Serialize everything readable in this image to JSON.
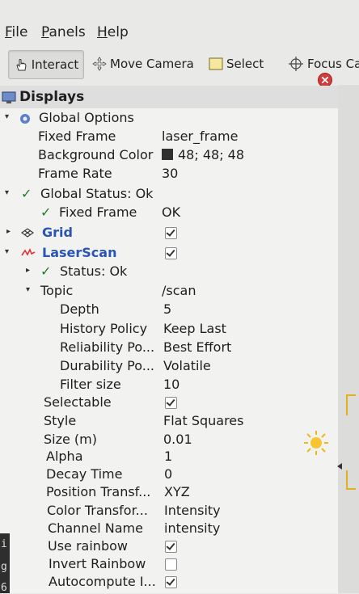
{
  "menubar": {
    "file": {
      "u": "F",
      "rest": "ile"
    },
    "panels": {
      "u": "P",
      "rest": "anels"
    },
    "help": {
      "u": "H",
      "rest": "elp"
    }
  },
  "toolbar": {
    "interact": "Interact",
    "move_camera": "Move Camera",
    "select": "Select",
    "focus_camera": "Focus Ca"
  },
  "displays": {
    "title": "Displays",
    "rows": [
      {
        "label": "Global Options",
        "value": ""
      },
      {
        "label": "Fixed Frame",
        "value": "laser_frame"
      },
      {
        "label": "Background Color",
        "value": "48; 48; 48"
      },
      {
        "label": "Frame Rate",
        "value": "30"
      },
      {
        "label": "Global Status: Ok",
        "value": ""
      },
      {
        "label": "Fixed Frame",
        "value": "OK"
      },
      {
        "label": "Grid",
        "value": true
      },
      {
        "label": "LaserScan",
        "value": true
      },
      {
        "label": "Status: Ok",
        "value": ""
      },
      {
        "label": "Topic",
        "value": "/scan"
      },
      {
        "label": "Depth",
        "value": "5"
      },
      {
        "label": "History Policy",
        "value": "Keep Last"
      },
      {
        "label": "Reliability Po...",
        "value": "Best Effort"
      },
      {
        "label": "Durability Po...",
        "value": "Volatile"
      },
      {
        "label": "Filter size",
        "value": "10"
      },
      {
        "label": "Selectable",
        "value": true
      },
      {
        "label": "Style",
        "value": "Flat Squares"
      },
      {
        "label": "Size (m)",
        "value": "0.01"
      },
      {
        "label": "Alpha",
        "value": "1"
      },
      {
        "label": "Decay Time",
        "value": "0"
      },
      {
        "label": "Position Transf...",
        "value": "XYZ"
      },
      {
        "label": "Color Transfor...",
        "value": "Intensity"
      },
      {
        "label": "Channel Name",
        "value": "intensity"
      },
      {
        "label": "Use rainbow",
        "value": true
      },
      {
        "label": "Invert Rainbow",
        "value": false
      },
      {
        "label": "Autocompute I...",
        "value": true
      }
    ]
  },
  "terminal_fragments": [
    "i",
    "g",
    "6"
  ],
  "colors": {
    "background_swatch": "#303030",
    "accent_blue": "#2a55b5",
    "status_ok_green": "#1f7a1f",
    "close_red": "#d53b3b",
    "camera_bracket_yellow": "#e3b21a"
  }
}
